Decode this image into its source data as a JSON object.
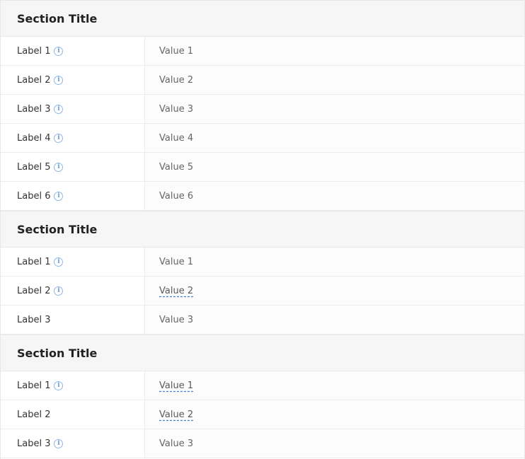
{
  "sections": [
    {
      "title": "Section Title",
      "rows": [
        {
          "label": "Label 1",
          "info": true,
          "value": "Value 1",
          "link": false
        },
        {
          "label": "Label 2",
          "info": true,
          "value": "Value 2",
          "link": false
        },
        {
          "label": "Label 3",
          "info": true,
          "value": "Value 3",
          "link": false
        },
        {
          "label": "Label 4",
          "info": true,
          "value": "Value 4",
          "link": false
        },
        {
          "label": "Label 5",
          "info": true,
          "value": "Value 5",
          "link": false
        },
        {
          "label": "Label 6",
          "info": true,
          "value": "Value 6",
          "link": false
        }
      ]
    },
    {
      "title": "Section Title",
      "rows": [
        {
          "label": "Label 1",
          "info": true,
          "value": "Value 1",
          "link": false
        },
        {
          "label": "Label 2",
          "info": true,
          "value": "Value 2",
          "link": true
        },
        {
          "label": "Label 3",
          "info": false,
          "value": "Value 3",
          "link": false
        }
      ]
    },
    {
      "title": "Section Title",
      "rows": [
        {
          "label": "Label 1",
          "info": true,
          "value": "Value 1",
          "link": true
        },
        {
          "label": "Label 2",
          "info": false,
          "value": "Value 2",
          "link": true
        },
        {
          "label": "Label 3",
          "info": true,
          "value": "Value 3",
          "link": false
        }
      ]
    }
  ],
  "icons": {
    "info": "info-icon"
  },
  "colors": {
    "link_underline": "#3d7fd6",
    "info_icon": "#6a9fd8"
  }
}
